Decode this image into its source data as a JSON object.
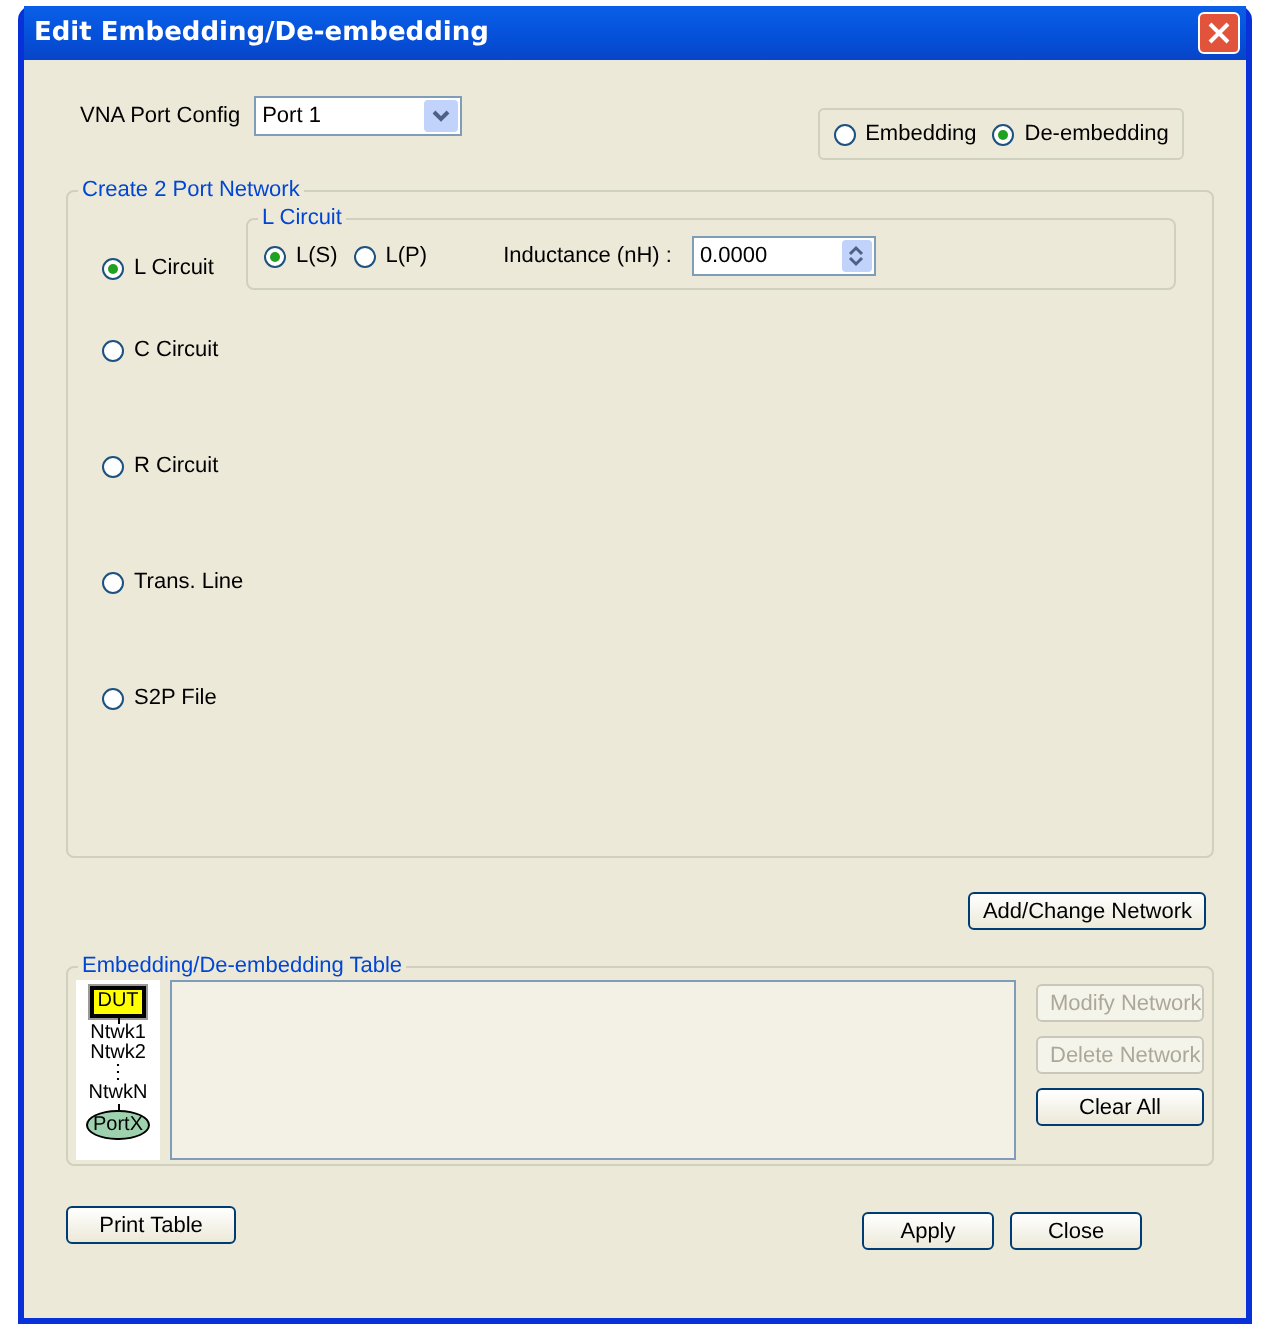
{
  "window": {
    "title": "Edit Embedding/De-embedding"
  },
  "port_config": {
    "label": "VNA Port Config",
    "value": "Port 1"
  },
  "modes": [
    {
      "label": "Embedding",
      "selected": false
    },
    {
      "label": "De-embedding",
      "selected": true
    }
  ],
  "network_group": {
    "title": "Create 2 Port Network",
    "circuits": [
      {
        "label": "L Circuit",
        "selected": true
      },
      {
        "label": "C Circuit",
        "selected": false
      },
      {
        "label": "R Circuit",
        "selected": false
      },
      {
        "label": "Trans. Line",
        "selected": false
      },
      {
        "label": "S2P File",
        "selected": false
      }
    ],
    "l_circuit": {
      "title": "L Circuit",
      "options": [
        {
          "label": "L(S)",
          "selected": true
        },
        {
          "label": "L(P)",
          "selected": false
        }
      ],
      "inductance": {
        "label": "Inductance (nH) :",
        "value": "0.0000"
      }
    }
  },
  "add_button": {
    "label": "Add/Change Network"
  },
  "table_group": {
    "title": "Embedding/De-embedding Table",
    "diagram": {
      "dut": "DUT",
      "networks": [
        "Ntwk1",
        "Ntwk2",
        "⋮",
        "NtwkN"
      ],
      "port": "PortX"
    },
    "buttons": [
      {
        "label": "Modify Network",
        "disabled": true
      },
      {
        "label": "Delete Network",
        "disabled": true
      },
      {
        "label": "Clear All",
        "disabled": false
      }
    ]
  },
  "footer": {
    "print": "Print Table",
    "buttons": [
      "Apply",
      "Close"
    ]
  }
}
